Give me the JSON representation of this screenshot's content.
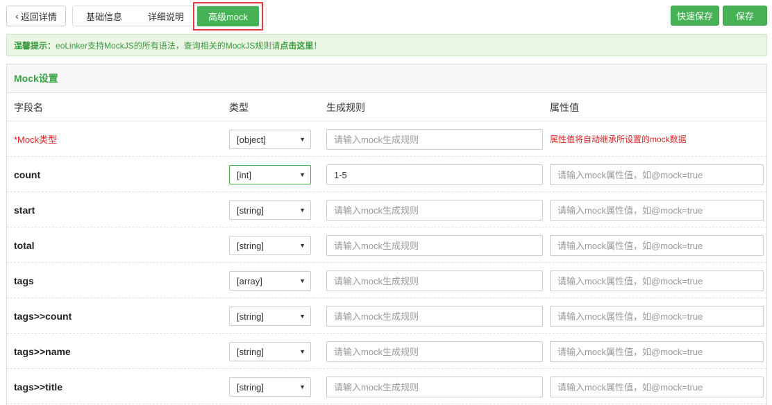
{
  "toolbar": {
    "back_label": "返回详情",
    "tabs": [
      "基础信息",
      "详细说明"
    ],
    "active_tab": "高级mock",
    "quick_save_label": "快速保存",
    "save_label": "保存"
  },
  "tip": {
    "prefix": "温馨提示：",
    "text": "eoLinker支持MockJS的所有语法，查询相关的MockJS规则请 ",
    "link": "点击这里",
    "suffix": "！"
  },
  "panel": {
    "title": "Mock设置",
    "columns": [
      "字段名",
      "类型",
      "生成规则",
      "属性值"
    ]
  },
  "root_row": {
    "name": "*Mock类型",
    "type": "[object]",
    "rule_placeholder": "请输入mock生成规则",
    "attr_note": "属性值将自动继承所设置的mock数据"
  },
  "rows": [
    {
      "name": "count",
      "type": "[int]",
      "rule_value": "1-5",
      "rule_placeholder": "请输入mock生成规则",
      "attr_placeholder": "请输入mock属性值，如@mock=true"
    },
    {
      "name": "start",
      "type": "[string]",
      "rule_value": "",
      "rule_placeholder": "请输入mock生成规则",
      "attr_placeholder": "请输入mock属性值，如@mock=true"
    },
    {
      "name": "total",
      "type": "[string]",
      "rule_value": "",
      "rule_placeholder": "请输入mock生成规则",
      "attr_placeholder": "请输入mock属性值，如@mock=true"
    },
    {
      "name": "tags",
      "type": "[array]",
      "rule_value": "",
      "rule_placeholder": "请输入mock生成规则",
      "attr_placeholder": "请输入mock属性值，如@mock=true"
    },
    {
      "name": "tags>>count",
      "type": "[string]",
      "rule_value": "",
      "rule_placeholder": "请输入mock生成规则",
      "attr_placeholder": "请输入mock属性值，如@mock=true"
    },
    {
      "name": "tags>>name",
      "type": "[string]",
      "rule_value": "",
      "rule_placeholder": "请输入mock生成规则",
      "attr_placeholder": "请输入mock属性值，如@mock=true"
    },
    {
      "name": "tags>>title",
      "type": "[string]",
      "rule_value": "",
      "rule_placeholder": "请输入mock生成规则",
      "attr_placeholder": "请输入mock属性值，如@mock=true"
    }
  ],
  "colors": {
    "accent": "#46b255",
    "highlight_border": "#e23d3d",
    "required": "#dd2222"
  }
}
